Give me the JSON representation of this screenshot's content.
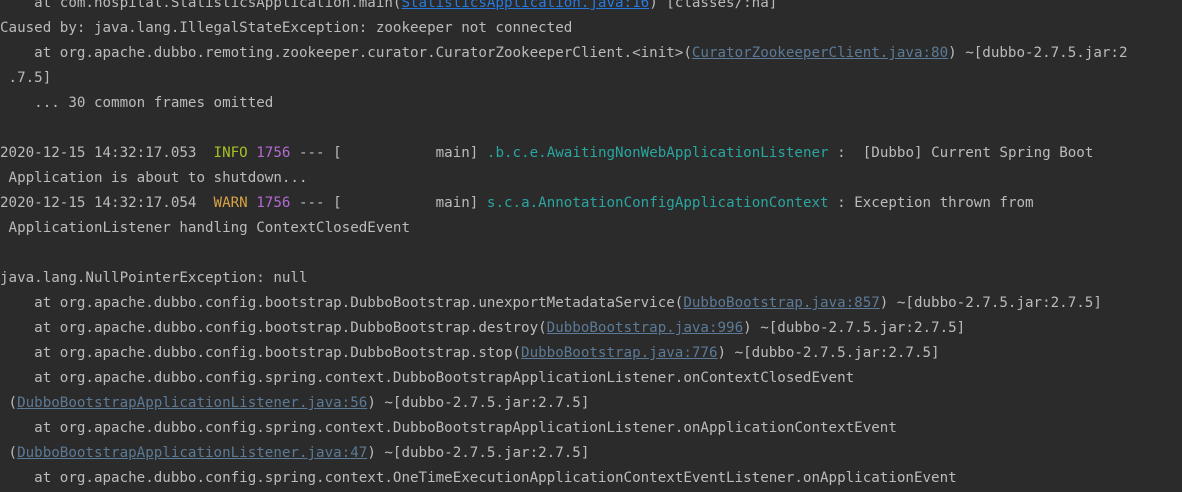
{
  "colors": {
    "background": "#2b2b2b",
    "text": "#bbbbbb",
    "link": "#5c7a96",
    "link_active": "#287bde",
    "info_level": "#a8c023",
    "warn_level": "#d9a343",
    "pid": "#b26ad1",
    "logger": "#2aa5a0"
  },
  "lines": [
    {
      "segments": [
        {
          "t": "    at com.hospital.StatisticsApplication.main("
        },
        {
          "t": "StatisticsApplication.java:16",
          "cls": "link blue"
        },
        {
          "t": ") [classes/:na]"
        }
      ]
    },
    {
      "segments": [
        {
          "t": "Caused by: java.lang.IllegalStateException: zookeeper not connected"
        }
      ]
    },
    {
      "segments": [
        {
          "t": "    at org.apache.dubbo.remoting.zookeeper.curator.CuratorZookeeperClient.<init>("
        },
        {
          "t": "CuratorZookeeperClient.java:80",
          "cls": "link"
        },
        {
          "t": ") ~[dubbo-2.7.5.jar:2"
        }
      ]
    },
    {
      "segments": [
        {
          "t": " .7.5]"
        }
      ]
    },
    {
      "segments": [
        {
          "t": "    ... 30 common frames omitted"
        }
      ]
    },
    {
      "segments": []
    },
    {
      "segments": [
        {
          "t": "2020-12-15 14:32:17.053  "
        },
        {
          "t": "INFO",
          "cls": "info"
        },
        {
          "t": " "
        },
        {
          "t": "1756",
          "cls": "pid"
        },
        {
          "t": " --- [           main] "
        },
        {
          "t": ".b.c.e.AwaitingNonWebApplicationListener",
          "cls": "logger"
        },
        {
          "t": " :  [Dubbo] Current Spring Boot"
        }
      ]
    },
    {
      "segments": [
        {
          "t": " Application is about to shutdown..."
        }
      ]
    },
    {
      "segments": [
        {
          "t": "2020-12-15 14:32:17.054  "
        },
        {
          "t": "WARN",
          "cls": "warn"
        },
        {
          "t": " "
        },
        {
          "t": "1756",
          "cls": "pid"
        },
        {
          "t": " --- [           main] "
        },
        {
          "t": "s.c.a.AnnotationConfigApplicationContext",
          "cls": "logger"
        },
        {
          "t": " : Exception thrown from"
        }
      ]
    },
    {
      "segments": [
        {
          "t": " ApplicationListener handling ContextClosedEvent"
        }
      ]
    },
    {
      "segments": []
    },
    {
      "segments": [
        {
          "t": "java.lang.NullPointerException: null"
        }
      ]
    },
    {
      "segments": [
        {
          "t": "    at org.apache.dubbo.config.bootstrap.DubboBootstrap.unexportMetadataService("
        },
        {
          "t": "DubboBootstrap.java:857",
          "cls": "link"
        },
        {
          "t": ") ~[dubbo-2.7.5.jar:2.7.5]"
        }
      ]
    },
    {
      "segments": [
        {
          "t": "    at org.apache.dubbo.config.bootstrap.DubboBootstrap.destroy("
        },
        {
          "t": "DubboBootstrap.java:996",
          "cls": "link"
        },
        {
          "t": ") ~[dubbo-2.7.5.jar:2.7.5]"
        }
      ]
    },
    {
      "segments": [
        {
          "t": "    at org.apache.dubbo.config.bootstrap.DubboBootstrap.stop("
        },
        {
          "t": "DubboBootstrap.java:776",
          "cls": "link"
        },
        {
          "t": ") ~[dubbo-2.7.5.jar:2.7.5]"
        }
      ]
    },
    {
      "segments": [
        {
          "t": "    at org.apache.dubbo.config.spring.context.DubboBootstrapApplicationListener.onContextClosedEvent"
        }
      ]
    },
    {
      "segments": [
        {
          "t": " ("
        },
        {
          "t": "DubboBootstrapApplicationListener.java:56",
          "cls": "link"
        },
        {
          "t": ") ~[dubbo-2.7.5.jar:2.7.5]"
        }
      ]
    },
    {
      "segments": [
        {
          "t": "    at org.apache.dubbo.config.spring.context.DubboBootstrapApplicationListener.onApplicationContextEvent"
        }
      ]
    },
    {
      "segments": [
        {
          "t": " ("
        },
        {
          "t": "DubboBootstrapApplicationListener.java:47",
          "cls": "link"
        },
        {
          "t": ") ~[dubbo-2.7.5.jar:2.7.5]"
        }
      ]
    },
    {
      "segments": [
        {
          "t": "    at org.apache.dubbo.config.spring.context.OneTimeExecutionApplicationContextEventListener.onApplicationEvent"
        }
      ]
    }
  ]
}
